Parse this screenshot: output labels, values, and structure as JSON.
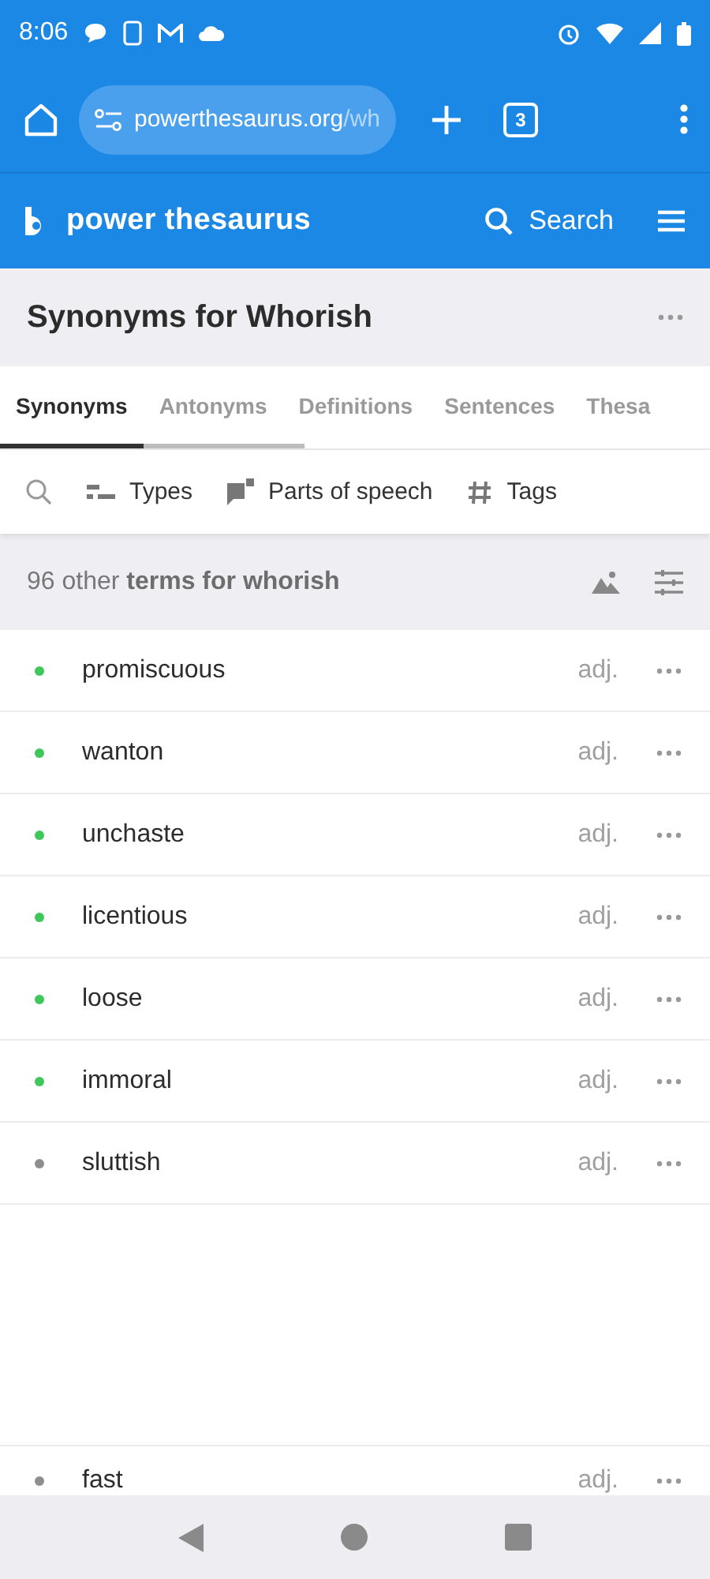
{
  "status_bar": {
    "time": "8:06"
  },
  "browser": {
    "url_host": "powerthesaurus.org",
    "url_path": "/wh",
    "tab_count": "3"
  },
  "site_header": {
    "logo_text": "power thesaurus",
    "search_label": "Search"
  },
  "page_title": "Synonyms for Whorish",
  "tabs": [
    {
      "label": "Synonyms",
      "selected": true
    },
    {
      "label": "Antonyms",
      "selected": false
    },
    {
      "label": "Definitions",
      "selected": false
    },
    {
      "label": "Sentences",
      "selected": false
    },
    {
      "label": "Thesa",
      "selected": false
    }
  ],
  "filters": [
    {
      "kind": "types",
      "label": "Types"
    },
    {
      "kind": "pos",
      "label": "Parts of speech"
    },
    {
      "kind": "tags",
      "label": "Tags"
    }
  ],
  "count_text": "96 other **terms for whorish**",
  "terms": [
    {
      "word": "promiscuous",
      "pos": "adj.",
      "color": "#3ec75a"
    },
    {
      "word": "wanton",
      "pos": "adj.",
      "color": "#3ec75a"
    },
    {
      "word": "unchaste",
      "pos": "adj.",
      "color": "#3ec75a"
    },
    {
      "word": "licentious",
      "pos": "adj.",
      "color": "#3ec75a"
    },
    {
      "word": "loose",
      "pos": "adj.",
      "color": "#3ec75a"
    },
    {
      "word": "immoral",
      "pos": "adj.",
      "color": "#3ec75a"
    },
    {
      "word": "sluttish",
      "pos": "adj.",
      "color": "#8e8e8e"
    }
  ],
  "more_terms": [
    {
      "word": "fast",
      "pos": "adj.",
      "color": "#8e8e8e"
    }
  ]
}
